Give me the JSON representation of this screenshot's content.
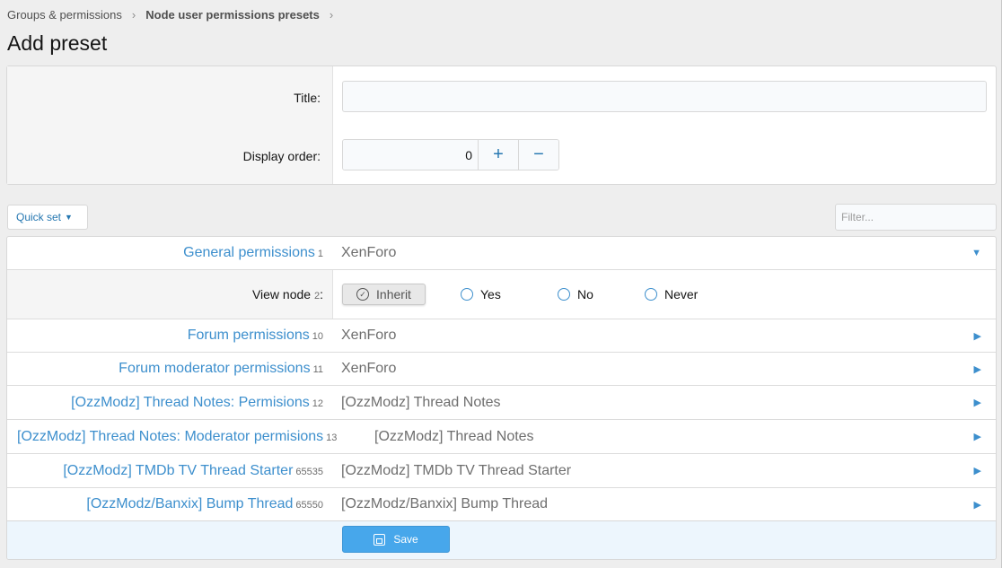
{
  "breadcrumb": {
    "items": [
      "Groups & permissions",
      "Node user permissions presets"
    ],
    "separator": "›"
  },
  "page": {
    "title": "Add preset"
  },
  "form": {
    "title_label": "Title:",
    "title_value": "",
    "order_label": "Display order:",
    "order_value": "0",
    "plus": "+",
    "minus": "−"
  },
  "toolbar": {
    "quickset_label": "Quick set",
    "filter_placeholder": "Filter..."
  },
  "groups": [
    {
      "title": "General permissions",
      "count": "1",
      "provider": "XenForo",
      "expanded": true
    },
    {
      "title": "Forum permissions",
      "count": "10",
      "provider": "XenForo",
      "expanded": false
    },
    {
      "title": "Forum moderator permissions",
      "count": "11",
      "provider": "XenForo",
      "expanded": false
    },
    {
      "title": "[OzzModz] Thread Notes: Permisions",
      "count": "12",
      "provider": "[OzzModz] Thread Notes",
      "expanded": false
    },
    {
      "title": "[OzzModz] Thread Notes: Moderator permisions",
      "count": "13",
      "provider": "[OzzModz] Thread Notes",
      "expanded": false
    },
    {
      "title": "[OzzModz] TMDb TV Thread Starter",
      "count": "65535",
      "provider": "[OzzModz] TMDb TV Thread Starter",
      "expanded": false
    },
    {
      "title": "[OzzModz/Banxix] Bump Thread",
      "count": "65550",
      "provider": "[OzzModz/Banxix] Bump Thread",
      "expanded": false
    }
  ],
  "view_node": {
    "label": "View node",
    "count": "2",
    "suffix": ":",
    "options": {
      "inherit": "Inherit",
      "yes": "Yes",
      "no": "No",
      "never": "Never"
    },
    "selected": "inherit"
  },
  "footer": {
    "save_label": "Save"
  },
  "colors": {
    "accent": "#47a7eb",
    "link": "#3d8fcd"
  }
}
